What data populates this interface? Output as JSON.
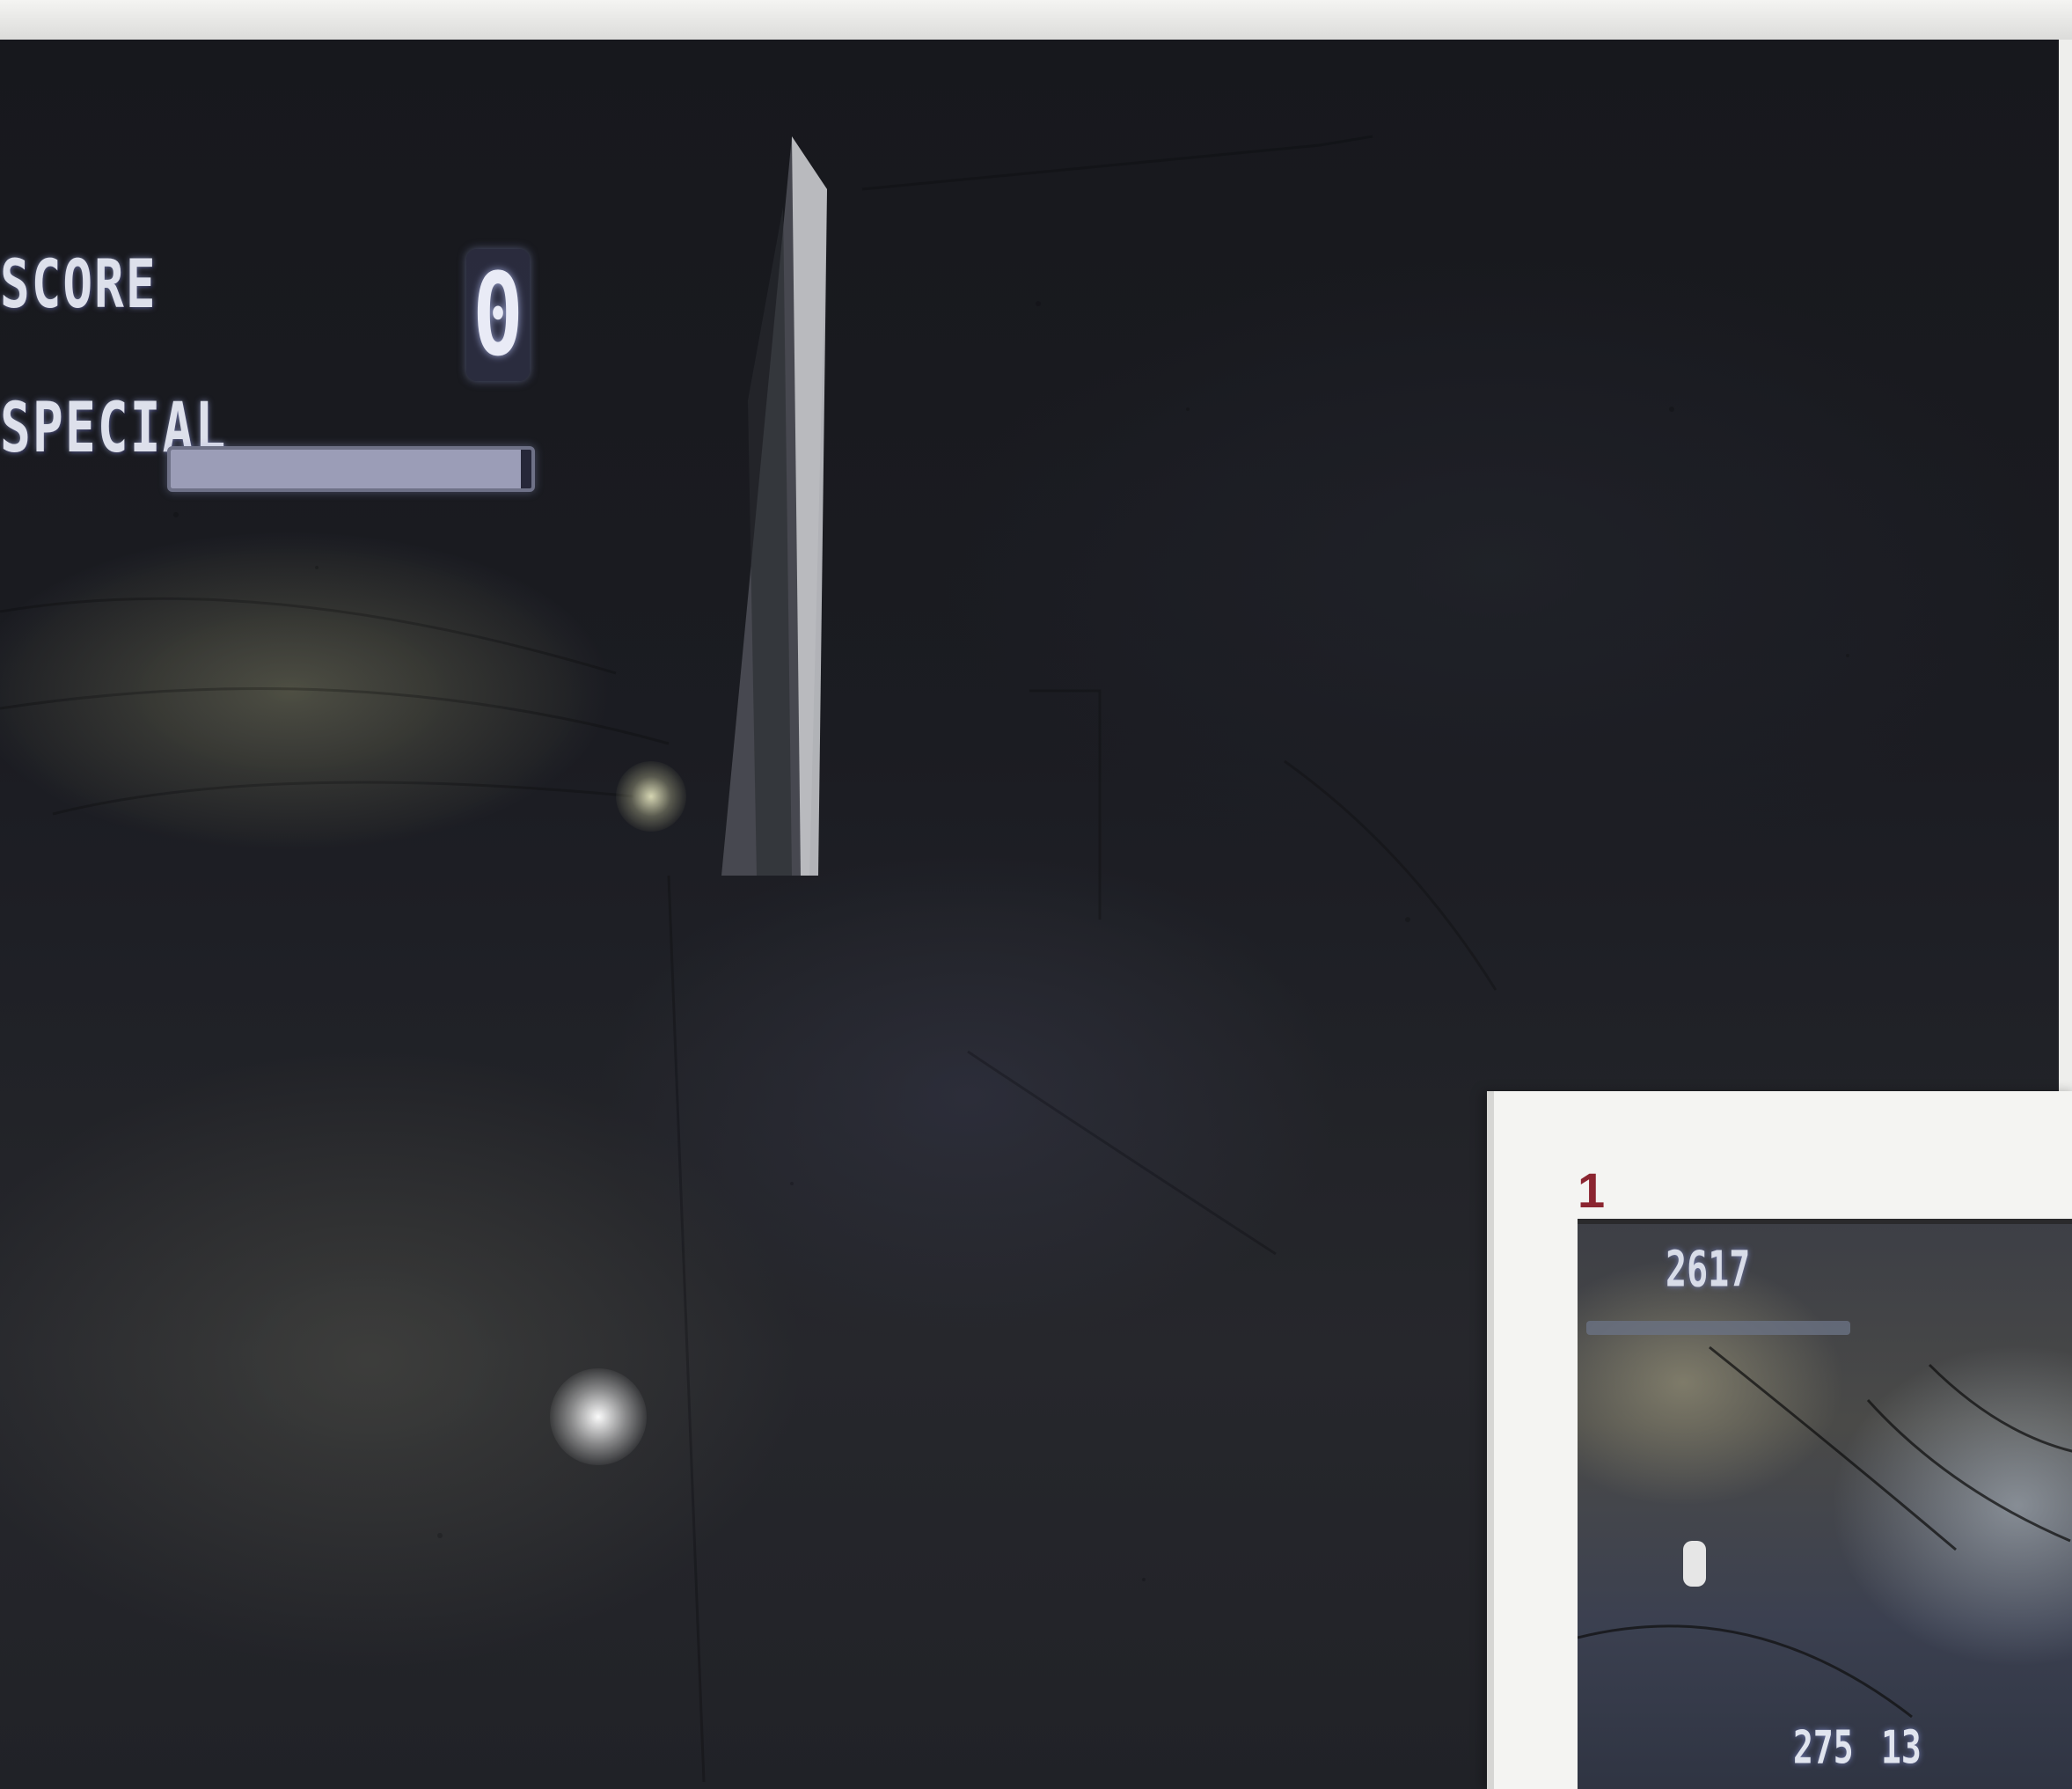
{
  "hud": {
    "score_label": "SCORE",
    "score_value": "0",
    "special_label": "SPECIAL",
    "special_level": 0.97
  },
  "inset": {
    "number": "1",
    "top_value": "2617",
    "bottom_left_value": "275",
    "bottom_right_value": "13"
  },
  "colors": {
    "hud_text": "#d9dbe6",
    "inset_number": "#8b2530",
    "scene_dark": "#202126"
  },
  "icons": {
    "tower": "tower-icon",
    "lamp": "lamp-icon"
  }
}
